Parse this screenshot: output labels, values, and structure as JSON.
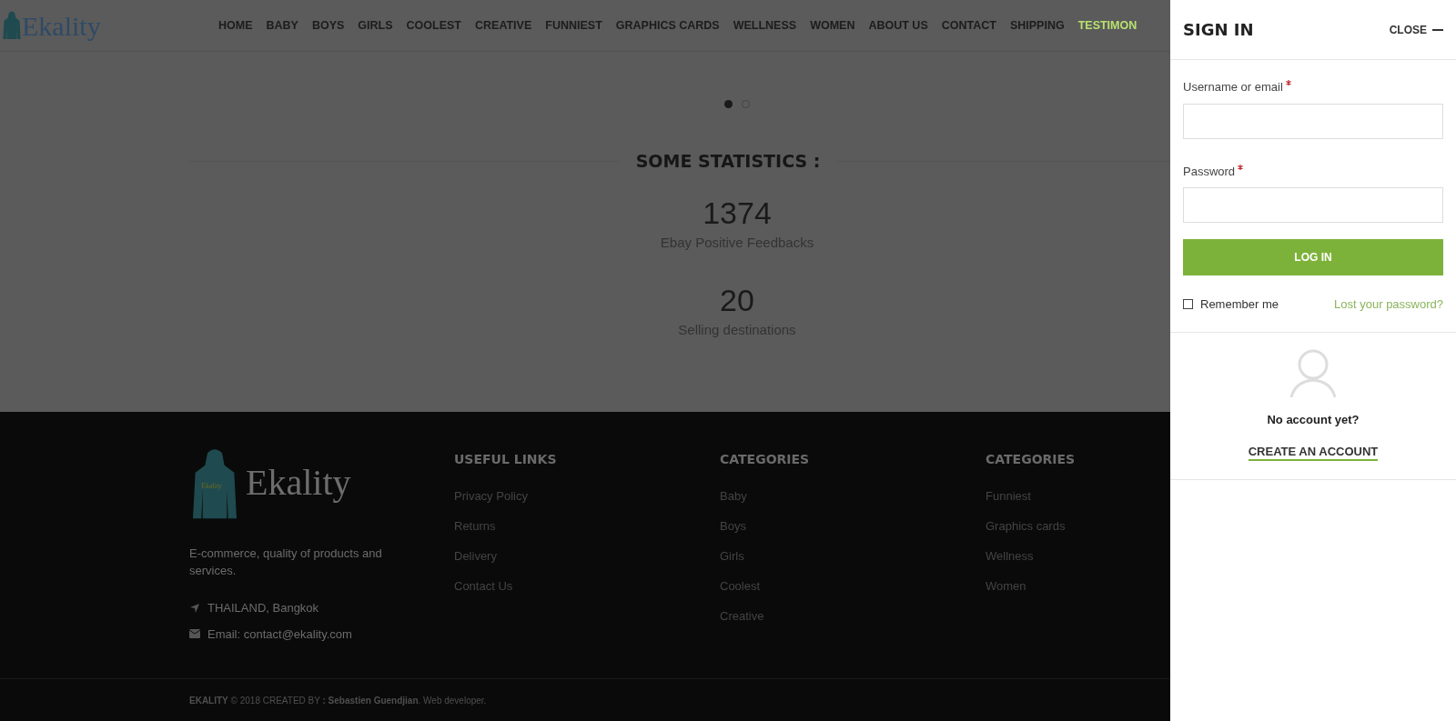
{
  "header": {
    "logo": "Ekality",
    "nav": [
      {
        "label": "HOME",
        "selected": false
      },
      {
        "label": "BABY",
        "selected": false
      },
      {
        "label": "BOYS",
        "selected": false
      },
      {
        "label": "GIRLS",
        "selected": false
      },
      {
        "label": "COOLEST",
        "selected": false
      },
      {
        "label": "CREATIVE",
        "selected": false
      },
      {
        "label": "FUNNIEST",
        "selected": false
      },
      {
        "label": "GRAPHICS CARDS",
        "selected": false
      },
      {
        "label": "WELLNESS",
        "selected": false
      },
      {
        "label": "WOMEN",
        "selected": false
      },
      {
        "label": "ABOUT US",
        "selected": false
      },
      {
        "label": "CONTACT",
        "selected": false
      },
      {
        "label": "SHIPPING",
        "selected": false
      },
      {
        "label": "TESTIMON",
        "selected": true
      }
    ]
  },
  "carousel": {
    "dots": [
      {
        "selected": true
      },
      {
        "selected": false
      }
    ]
  },
  "statistics": {
    "title": "SOME STATISTICS :",
    "items": [
      {
        "value": "1374",
        "label": "Ebay Positive Feedbacks"
      },
      {
        "value": "20",
        "label": "Selling destinations"
      }
    ]
  },
  "footer": {
    "logo": "Ekality",
    "logo_badge": "Ekality",
    "tagline": "E-commerce, quality of products and services.",
    "address": "THAILAND, Bangkok",
    "email": "Email: contact@ekality.com",
    "columns": [
      {
        "title": "USEFUL LINKS",
        "links": [
          "Privacy Policy",
          "Returns",
          "Delivery",
          "Contact Us"
        ]
      },
      {
        "title": "CATEGORIES",
        "links": [
          "Baby",
          "Boys",
          "Girls",
          "Coolest",
          "Creative"
        ]
      },
      {
        "title": "CATEGORIES",
        "links": [
          "Funniest",
          "Graphics cards",
          "Wellness",
          "Women"
        ]
      }
    ],
    "copyright": "**EKALITY** © 2018 CREATED BY **: Sebastien Guendjian**. Web developer."
  },
  "sign_in": {
    "title": "SIGN IN",
    "close": "CLOSE",
    "fields": [
      {
        "label": "Username or email",
        "required": true
      },
      {
        "label": "Password",
        "required": true
      }
    ],
    "submit": "LOG IN",
    "remember": {
      "label": "Remember me",
      "checked": false
    },
    "lost_password": "Lost your password?",
    "no_account": "No account yet?",
    "create_account": "CREATE AN ACCOUNT"
  }
}
